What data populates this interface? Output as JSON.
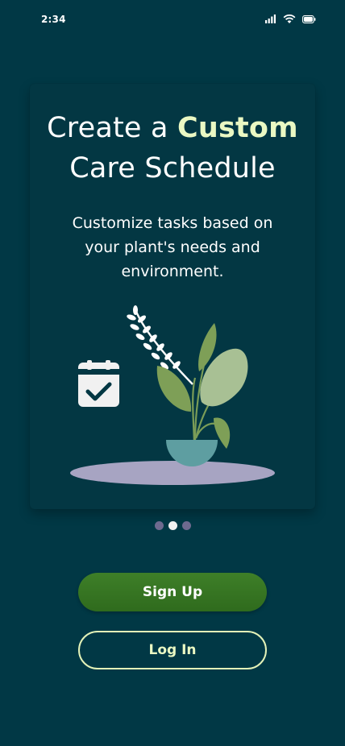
{
  "status_bar": {
    "time": "2:34",
    "icons": [
      "cellular-signal-icon",
      "wifi-icon",
      "battery-icon"
    ]
  },
  "onboarding": {
    "headline_part1": "Create a ",
    "headline_accent": "Custom",
    "headline_part2": "Care Schedule",
    "subtitle": "Customize tasks based on your plant's needs and environment.",
    "illustration_icons": [
      "calendar-check-icon",
      "potted-plant-illustration"
    ],
    "page_indicator": {
      "total": 3,
      "active_index": 1
    }
  },
  "actions": {
    "signup_label": "Sign Up",
    "login_label": "Log In"
  },
  "colors": {
    "background": "#013845",
    "card": "#033743",
    "accent_text": "#eaf8c3",
    "primary_button": "#3a7a25",
    "outline_button": "#e3f2b8",
    "dot_inactive": "#6e6a8f",
    "dot_active": "#f1f1f1"
  }
}
